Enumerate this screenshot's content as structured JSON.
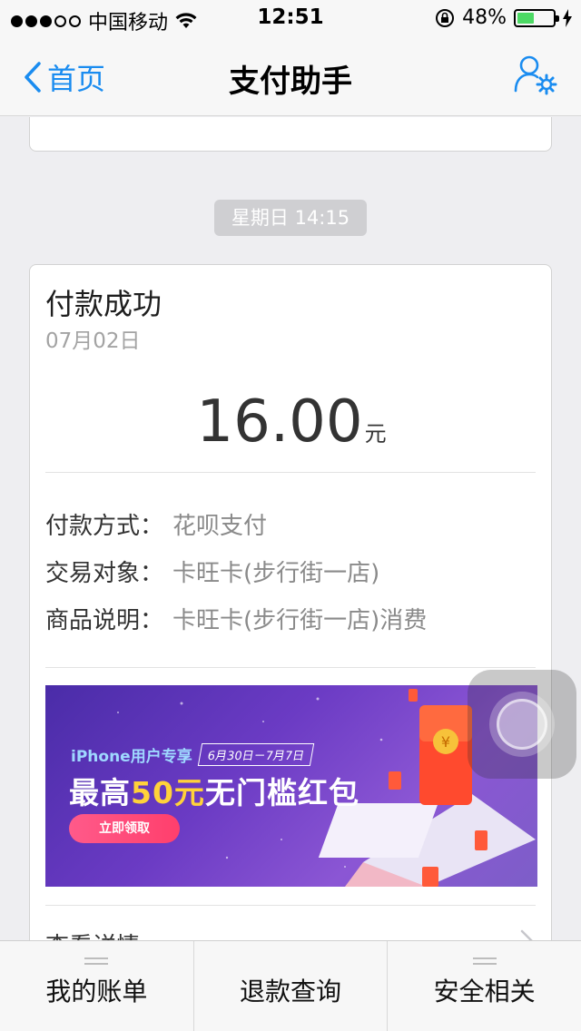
{
  "status_bar": {
    "carrier": "中国移动",
    "time": "12:51",
    "battery_percent": "48%",
    "battery_level": 0.48,
    "battery_color": "#4cd964"
  },
  "nav": {
    "back_label": "首页",
    "title": "支付助手",
    "accent_color": "#1a8cf0",
    "right_icon": "user-settings-icon"
  },
  "timestamp_label": "星期日 14:15",
  "card": {
    "title": "付款成功",
    "date": "07月02日",
    "amount": "16.00",
    "amount_unit": "元",
    "details": [
      {
        "key": "付款方式：",
        "value": "花呗支付"
      },
      {
        "key": "交易对象：",
        "value": "卡旺卡(步行街一店)"
      },
      {
        "key": "商品说明：",
        "value": "卡旺卡(步行街一店)消费"
      }
    ],
    "banner": {
      "tag": "iPhone用户专享",
      "date_range": "6月30日－7月7日",
      "headline_prefix": "最高",
      "headline_highlight": "50元",
      "headline_suffix": "无门槛红包",
      "button_label": "立即领取"
    },
    "more_label": "查看详情"
  },
  "tabbar": {
    "tabs": [
      {
        "label": "我的账单"
      },
      {
        "label": "退款查询"
      },
      {
        "label": "安全相关"
      }
    ]
  }
}
